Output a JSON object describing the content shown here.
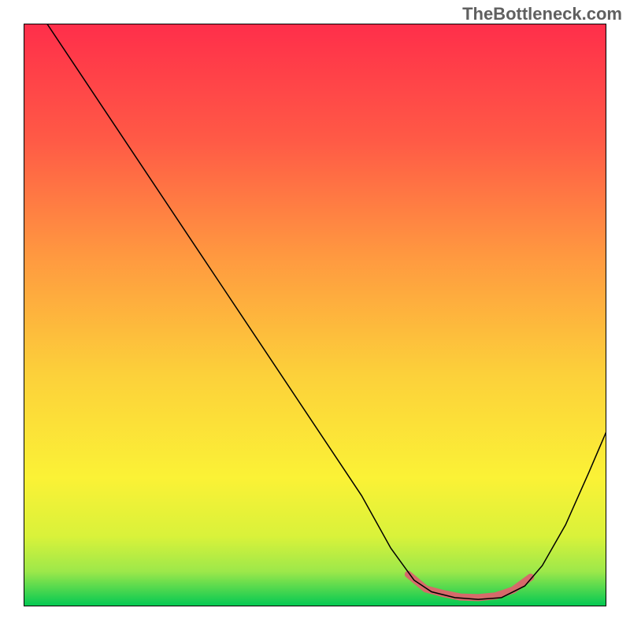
{
  "watermark": "TheBottleneck.com",
  "chart_data": {
    "type": "line",
    "title": "",
    "xlabel": "",
    "ylabel": "",
    "xlim": [
      0,
      100
    ],
    "ylim": [
      0,
      100
    ],
    "background": {
      "type": "vertical-gradient",
      "stops": [
        {
          "offset": 0,
          "color": "#ff2e4a"
        },
        {
          "offset": 20,
          "color": "#ff5a46"
        },
        {
          "offset": 40,
          "color": "#ff9940"
        },
        {
          "offset": 60,
          "color": "#fcd03a"
        },
        {
          "offset": 78,
          "color": "#fbf236"
        },
        {
          "offset": 88,
          "color": "#d9f23a"
        },
        {
          "offset": 94,
          "color": "#9de84a"
        },
        {
          "offset": 100,
          "color": "#00c853"
        }
      ]
    },
    "series": [
      {
        "name": "curve",
        "color": "#000000",
        "stroke_width": 1.5,
        "points": [
          {
            "x": 4,
            "y": 100
          },
          {
            "x": 10,
            "y": 91
          },
          {
            "x": 16,
            "y": 82
          },
          {
            "x": 22,
            "y": 73
          },
          {
            "x": 28,
            "y": 64
          },
          {
            "x": 34,
            "y": 55
          },
          {
            "x": 40,
            "y": 46
          },
          {
            "x": 46,
            "y": 37
          },
          {
            "x": 52,
            "y": 28
          },
          {
            "x": 58,
            "y": 19
          },
          {
            "x": 63,
            "y": 10
          },
          {
            "x": 67,
            "y": 4.5
          },
          {
            "x": 70,
            "y": 2.5
          },
          {
            "x": 74,
            "y": 1.5
          },
          {
            "x": 78,
            "y": 1.2
          },
          {
            "x": 82,
            "y": 1.5
          },
          {
            "x": 86,
            "y": 3.5
          },
          {
            "x": 89,
            "y": 7
          },
          {
            "x": 93,
            "y": 14
          },
          {
            "x": 97,
            "y": 23
          },
          {
            "x": 100,
            "y": 30
          }
        ]
      },
      {
        "name": "highlight",
        "color": "#d66a6a",
        "stroke_width": 9,
        "points": [
          {
            "x": 66,
            "y": 5.5
          },
          {
            "x": 69,
            "y": 3.0
          },
          {
            "x": 72,
            "y": 2.2
          },
          {
            "x": 75,
            "y": 1.6
          },
          {
            "x": 78,
            "y": 1.5
          },
          {
            "x": 81,
            "y": 1.8
          },
          {
            "x": 84,
            "y": 2.8
          },
          {
            "x": 87,
            "y": 5.0
          }
        ]
      }
    ]
  }
}
